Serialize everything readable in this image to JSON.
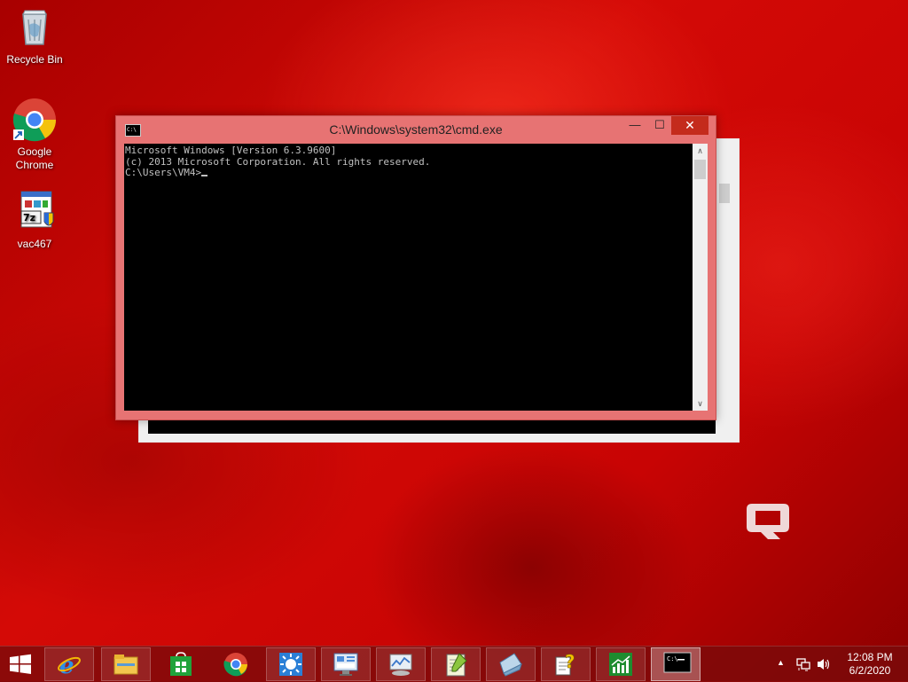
{
  "desktop": {
    "icons": [
      {
        "label": "Recycle Bin",
        "icon": "recycle-bin-icon"
      },
      {
        "label": "Google\nChrome",
        "icon": "chrome-icon"
      },
      {
        "label": "vac467",
        "icon": "installer-icon"
      }
    ]
  },
  "window": {
    "title": "C:\\Windows\\system32\\cmd.exe",
    "icon_text": "C:\\",
    "buttons": {
      "minimize": "—",
      "maximize": "☐",
      "close": "✕"
    },
    "console_lines": [
      "Microsoft Windows [Version 6.3.9600]",
      "(c) 2013 Microsoft Corporation. All rights reserved.",
      "C:\\Users\\VM4>"
    ],
    "scroll_up": "∧",
    "scroll_down": "∨"
  },
  "taskbar": {
    "items": [
      {
        "name": "internet-explorer",
        "icon": "internet-explorer-icon"
      },
      {
        "name": "file-explorer",
        "icon": "folder-icon"
      },
      {
        "name": "store",
        "icon": "store-icon"
      },
      {
        "name": "chrome",
        "icon": "chrome-icon"
      },
      {
        "name": "brightness",
        "icon": "sun-icon"
      },
      {
        "name": "control-panel",
        "icon": "control-panel-icon"
      },
      {
        "name": "performance",
        "icon": "monitor-icon"
      },
      {
        "name": "notepad-plus",
        "icon": "notepad-icon"
      },
      {
        "name": "eraser",
        "icon": "eraser-icon"
      },
      {
        "name": "help",
        "icon": "help-icon"
      },
      {
        "name": "chart-app",
        "icon": "chart-icon"
      },
      {
        "name": "cmd",
        "icon": "cmd-icon"
      }
    ],
    "tray": {
      "arrow": "▲",
      "network": "network-icon",
      "volume": "volume-icon"
    },
    "time": "12:08 PM",
    "date": "6/2/2020"
  },
  "colors": {
    "accent": "#e77373",
    "close": "#c42b1c",
    "desktop": "#c80404"
  }
}
